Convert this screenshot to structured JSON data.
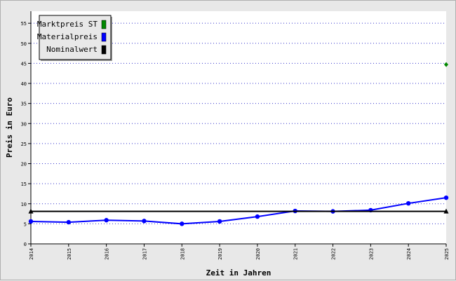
{
  "chart_data": {
    "type": "line",
    "title": "",
    "xlabel": "Zeit in Jahren",
    "ylabel": "Preis in Euro",
    "x": [
      "2014",
      "2015",
      "2016",
      "2017",
      "2018",
      "2019",
      "2020",
      "2021",
      "2022",
      "2023",
      "2024",
      "2025"
    ],
    "ylim": [
      0,
      58
    ],
    "yticks": [
      0,
      5,
      10,
      15,
      20,
      25,
      30,
      35,
      40,
      45,
      50,
      55
    ],
    "grid": true,
    "legend_position": "top-left",
    "series": [
      {
        "name": "Marktpreis ST",
        "color": "#008800",
        "marker": "diamond",
        "points": [
          {
            "x": "2025",
            "y": 44.7
          }
        ]
      },
      {
        "name": "Materialpreis",
        "color": "#0000ff",
        "marker": "circle",
        "values": [
          5.6,
          5.4,
          5.9,
          5.7,
          5.0,
          5.6,
          6.8,
          8.2,
          8.1,
          8.4,
          10.1,
          11.5
        ]
      },
      {
        "name": "Nominalwert",
        "color": "#000000",
        "marker": "triangle",
        "values": [
          8.1,
          8.1,
          8.1,
          8.1,
          8.1,
          8.1,
          8.1,
          8.1,
          8.1,
          8.1,
          8.1,
          8.1
        ]
      }
    ]
  }
}
